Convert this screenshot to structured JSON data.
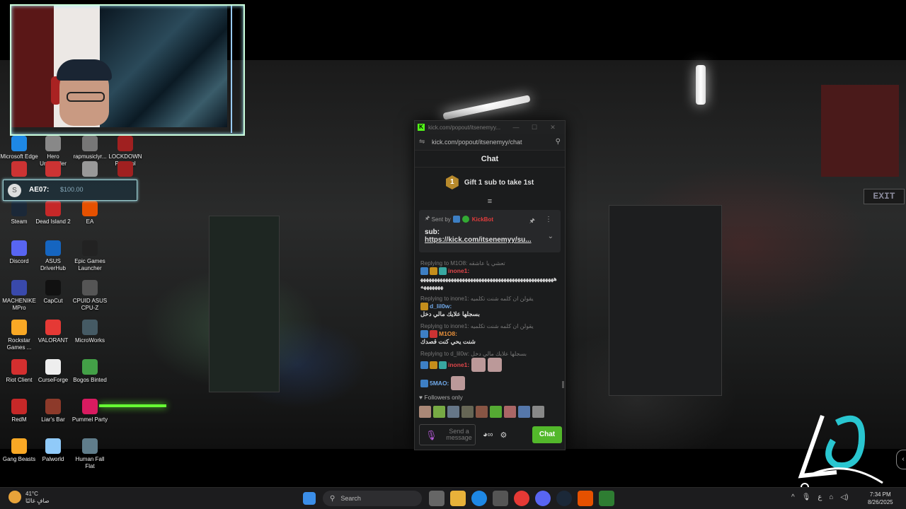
{
  "desktop": {
    "icons": [
      {
        "label": "Microsoft Edge",
        "icon": "edge-icon",
        "color": "#1e88e5"
      },
      {
        "label": "Hero Uninstaller",
        "icon": "hero-uninstaller-icon",
        "color": "#888888"
      },
      {
        "label": "rapmusiclyr...",
        "icon": "file-icon",
        "color": "#777777"
      },
      {
        "label": "LOCKDOWN Protocol",
        "icon": "lockdown-icon",
        "color": "#a02020"
      },
      {
        "label": "",
        "icon": "app-icon",
        "color": "#c33"
      },
      {
        "label": "",
        "icon": "app-icon",
        "color": "#c33"
      },
      {
        "label": "",
        "icon": "app-icon",
        "color": "#999"
      },
      {
        "label": "",
        "icon": "app-icon",
        "color": "#a02020"
      },
      {
        "label": "Steam",
        "icon": "steam-icon",
        "color": "#1b2838"
      },
      {
        "label": "Dead Island 2",
        "icon": "dead-island-icon",
        "color": "#c62828"
      },
      {
        "label": "EA",
        "icon": "ea-icon",
        "color": "#e65100"
      },
      {
        "label": "Discord",
        "icon": "discord-icon",
        "color": "#5865f2"
      },
      {
        "label": "ASUS DriverHub",
        "icon": "asus-driverhub-icon",
        "color": "#1565c0"
      },
      {
        "label": "Epic Games Launcher",
        "icon": "epic-games-icon",
        "color": "#222222"
      },
      {
        "label": "MACHENIKE MPro",
        "icon": "machenike-icon",
        "color": "#3949ab"
      },
      {
        "label": "CapCut",
        "icon": "capcut-icon",
        "color": "#111111"
      },
      {
        "label": "CPUID ASUS CPU-Z",
        "icon": "cpu-z-icon",
        "color": "#555555"
      },
      {
        "label": "Rockstar Games ...",
        "icon": "rockstar-icon",
        "color": "#f9a825"
      },
      {
        "label": "VALORANT",
        "icon": "valorant-icon",
        "color": "#e53935"
      },
      {
        "label": "MicroWorks",
        "icon": "microworks-icon",
        "color": "#455a64"
      },
      {
        "label": "Riot Client",
        "icon": "riot-client-icon",
        "color": "#d32f2f"
      },
      {
        "label": "CurseForge",
        "icon": "curseforge-icon",
        "color": "#eeeeee"
      },
      {
        "label": "Bogos Binted",
        "icon": "bogos-binted-icon",
        "color": "#43a047"
      },
      {
        "label": "RedM",
        "icon": "redm-icon",
        "color": "#c62828"
      },
      {
        "label": "Liar's Bar",
        "icon": "liars-bar-icon",
        "color": "#8d3a2a"
      },
      {
        "label": "Pummel Party",
        "icon": "pummel-party-icon",
        "color": "#d81b60"
      },
      {
        "label": "Gang Beasts",
        "icon": "gang-beasts-icon",
        "color": "#f9a825"
      },
      {
        "label": "Palworld",
        "icon": "palworld-icon",
        "color": "#90caf9"
      },
      {
        "label": "Human Fall Flat",
        "icon": "human-fall-flat-icon",
        "color": "#607d8b"
      }
    ]
  },
  "donation": {
    "name": "AE07:",
    "amount": "$100.00",
    "coin": "S"
  },
  "popup": {
    "title": "kick.com/popout/itsenemyy...",
    "url": "kick.com/popout/itsenemyy/chat",
    "header": "Chat",
    "gift_text": "Gift 1 sub to take 1st",
    "gift_rank": "1",
    "pinned": {
      "sent_by": "Sent by",
      "bot_name": "KickBot",
      "sub_label": "sub:",
      "link": "https://kick.com/itsenemyy/su..."
    },
    "messages": [
      {
        "reply": "Replying to M1O8: تعشي يا عاشقه",
        "user": "inone1:",
        "user_color": "u-red",
        "badges": [
          "b-blue",
          "b-gold",
          "b-teal"
        ],
        "text": "ههههههههههههههههههههههههههههههههههههههههههههههههههههههههه",
        "emotes": 0
      },
      {
        "reply": "Replying to inone1: يقولن ان كلمه شنت تكلميه",
        "user": "d_lil0w:",
        "user_color": "u-blue",
        "badges": [
          "b-gold"
        ],
        "text": "بسجلها علايك مالي دخل",
        "emotes": 0
      },
      {
        "reply": "Replying to inone1: يقولن ان كلمه شنت تكلميه",
        "user": "M1O8:",
        "user_color": "u-orange",
        "badges": [
          "b-blue",
          "b-red"
        ],
        "text": "شنت يحي كنت قصدك",
        "emotes": 0
      },
      {
        "reply": "Replying to d_lil0w: بسجلها علايك مالي دخل",
        "user": "inone1:",
        "user_color": "u-red",
        "badges": [
          "b-blue",
          "b-gold",
          "b-teal"
        ],
        "text": "",
        "emotes": 2
      },
      {
        "reply": "",
        "user": "5MAO:",
        "user_color": "u-blue",
        "badges": [
          "b-blue"
        ],
        "text": "",
        "emotes": 1
      }
    ],
    "followers_only": "Followers only",
    "input_placeholder": "Send a message",
    "chat_button": "Chat"
  },
  "taskbar": {
    "weather_temp": "41°C",
    "weather_desc": "صافٍ غالبًا",
    "search_placeholder": "Search",
    "tray_lang": "ع",
    "time": "7:34 PM",
    "date": "8/26/2025"
  },
  "colors": {
    "kick_green": "#53fc18",
    "chat_button": "#53b82b",
    "taskbar": "#1c1c1e"
  }
}
